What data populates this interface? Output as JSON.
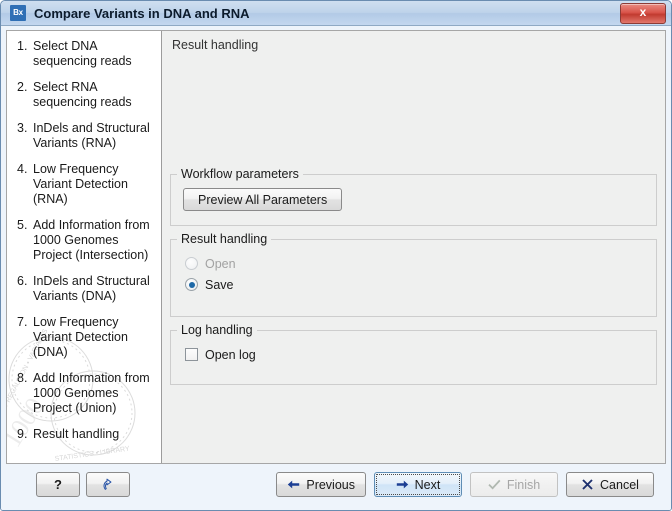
{
  "window": {
    "title": "Compare Variants in DNA and RNA",
    "app_icon_text": "Bx",
    "close_label": "x"
  },
  "sidebar": {
    "steps": [
      {
        "num": "1.",
        "label": "Select DNA sequencing reads"
      },
      {
        "num": "2.",
        "label": "Select RNA sequencing reads"
      },
      {
        "num": "3.",
        "label": "InDels and Structural Variants (RNA)"
      },
      {
        "num": "4.",
        "label": "Low Frequency Variant Detection (RNA)"
      },
      {
        "num": "5.",
        "label": "Add Information from 1000 Genomes Project (Intersection)"
      },
      {
        "num": "6.",
        "label": "InDels and Structural Variants (DNA)"
      },
      {
        "num": "7.",
        "label": "Low Frequency Variant Detection (DNA)"
      },
      {
        "num": "8.",
        "label": "Add Information from 1000 Genomes Project (Union)"
      },
      {
        "num": "9.",
        "label": "Result handling"
      }
    ]
  },
  "main": {
    "heading": "Result handling",
    "workflow_parameters": {
      "title": "Workflow parameters",
      "preview_button": "Preview All Parameters"
    },
    "result_handling": {
      "title": "Result handling",
      "options": [
        {
          "label": "Open",
          "selected": false,
          "enabled": false
        },
        {
          "label": "Save",
          "selected": true,
          "enabled": true
        }
      ]
    },
    "log_handling": {
      "title": "Log handling",
      "checkbox_label": "Open log",
      "checked": false
    }
  },
  "footer": {
    "help_label": "?",
    "reset_label": "",
    "previous_label": "Previous",
    "next_label": "Next",
    "finish_label": "Finish",
    "cancel_label": "Cancel"
  },
  "colors": {
    "titlebar_blue": "#bed3ea",
    "close_red": "#d9544a",
    "radio_accent": "#1d68a7",
    "arrow_navy": "#1c3f94",
    "default_button_border": "#5f8db5"
  }
}
